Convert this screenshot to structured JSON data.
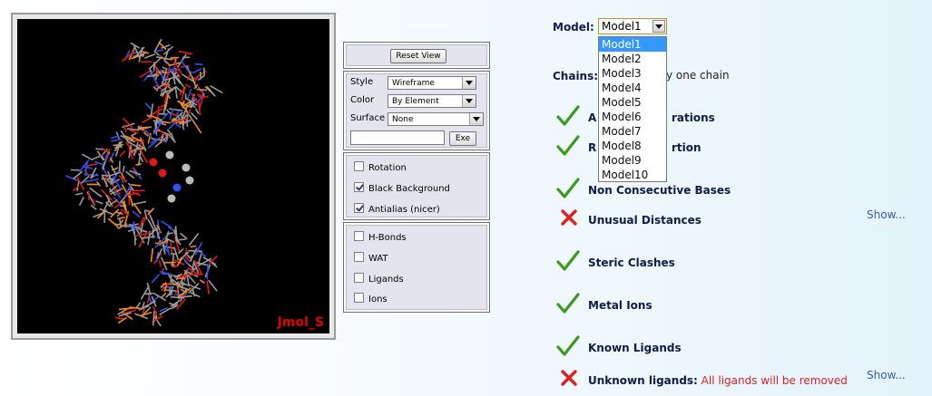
{
  "viewer": {
    "watermark": "Jmol_S"
  },
  "controls": {
    "reset_label": "Reset View",
    "style_label": "Style",
    "style_value": "Wireframe",
    "color_label": "Color",
    "color_value": "By Element",
    "surface_label": "Surface",
    "surface_value": "None",
    "exe_label": "Exe",
    "view_options": [
      {
        "label": "Rotation",
        "checked": false
      },
      {
        "label": "Black Background",
        "checked": true
      },
      {
        "label": "Antialias (nicer)",
        "checked": true
      }
    ],
    "show_options": [
      {
        "label": "H-Bonds",
        "checked": false
      },
      {
        "label": "WAT",
        "checked": false
      },
      {
        "label": "Ligands",
        "checked": false
      },
      {
        "label": "Ions",
        "checked": false
      }
    ]
  },
  "model": {
    "label": "Model:",
    "selected": "Model1",
    "options": [
      "Model1",
      "Model2",
      "Model3",
      "Model4",
      "Model5",
      "Model6",
      "Model7",
      "Model8",
      "Model9",
      "Model10"
    ]
  },
  "chains": {
    "label": "Chains:",
    "text_fragment": "y one chain"
  },
  "checks": [
    {
      "label": "A",
      "tail": "rations",
      "status": "ok"
    },
    {
      "label": "R",
      "tail": "rtion",
      "status": "ok"
    },
    {
      "label": "Non Consecutive Bases",
      "status": "ok"
    },
    {
      "label": "Unusual Distances",
      "status": "fail",
      "link": "Show..."
    },
    {
      "label": "Steric Clashes",
      "status": "ok"
    },
    {
      "label": "Metal Ions",
      "status": "ok"
    },
    {
      "label": "Known Ligands",
      "status": "ok"
    },
    {
      "label": "Unknown ligands:",
      "status": "fail",
      "note": "All ligands will be removed",
      "link": "Show..."
    }
  ],
  "colors": {
    "ok": "#3a9a1e",
    "fail": "#e02020",
    "selected": "#3399ff",
    "link": "#3060b8",
    "heading": "#0e1c4a"
  }
}
